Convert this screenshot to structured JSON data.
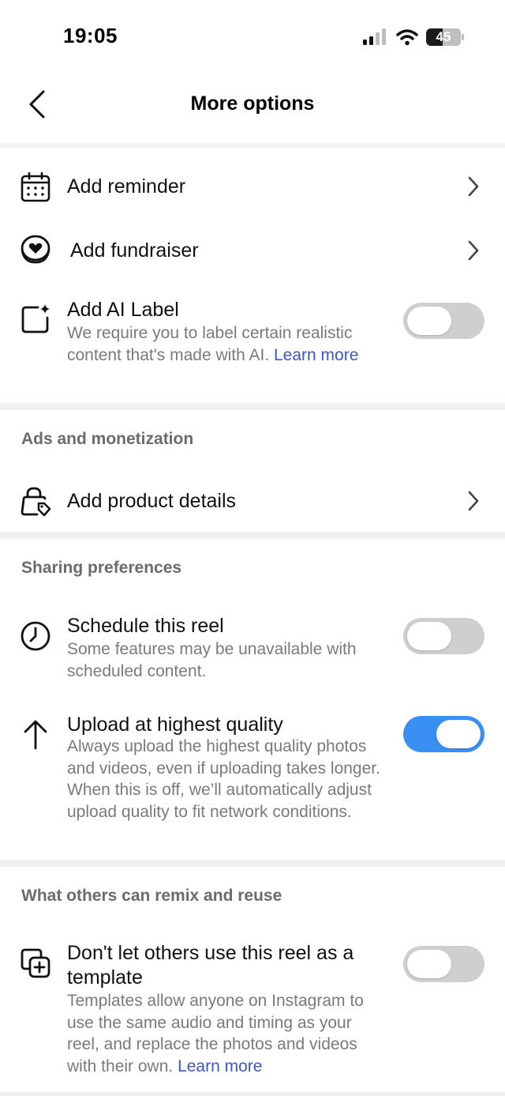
{
  "status_bar": {
    "time": "19:05",
    "battery": "45"
  },
  "header": {
    "title": "More options"
  },
  "rows": {
    "reminder": {
      "title": "Add reminder"
    },
    "fundraiser": {
      "title": "Add fundraiser"
    },
    "ai_label": {
      "title": "Add AI Label",
      "description": "We require you to label certain realistic content that's made with AI.",
      "link": "Learn more",
      "toggle_on": false
    },
    "product": {
      "title": "Add product details"
    },
    "schedule": {
      "title": "Schedule this reel",
      "description": "Some features may be unavailable with scheduled content.",
      "toggle_on": false
    },
    "quality": {
      "title": "Upload at highest quality",
      "description": "Always upload the highest quality photos and videos, even if uploading takes longer. When this is off, we’ll automatically adjust upload quality to fit network conditions.",
      "toggle_on": true
    },
    "template": {
      "title": "Don't let others use this reel as a template",
      "description": "Templates allow anyone on Instagram to use the same audio and timing as your reel, and replace the photos and videos with their own.",
      "link": "Learn more",
      "toggle_on": false
    }
  },
  "sections": {
    "ads": "Ads and monetization",
    "sharing": "Sharing preferences",
    "remix": "What others can remix and reuse"
  },
  "colors": {
    "accent": "#3a8ff2",
    "link": "#3a56d4",
    "toggle_off": "#cfcfcf"
  },
  "icons": {
    "back": "chevron-left-icon",
    "reminder": "calendar-icon",
    "fundraiser": "heart-coin-icon",
    "ai_label": "sparkle-square-icon",
    "product": "shopping-bag-tag-icon",
    "schedule": "clock-icon",
    "quality": "arrow-up-icon",
    "template": "add-copy-icon",
    "chevron": "chevron-right-icon"
  }
}
